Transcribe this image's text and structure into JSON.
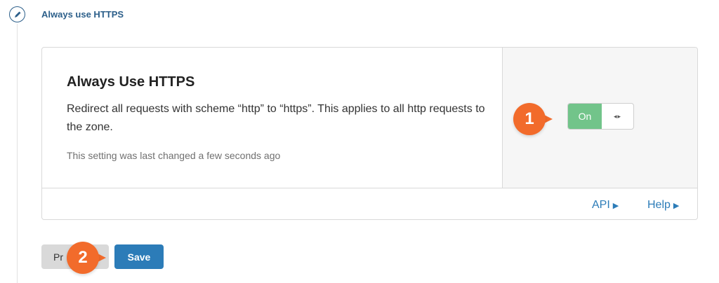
{
  "step": {
    "title": "Always use HTTPS",
    "icon": "pencil-icon"
  },
  "setting": {
    "title": "Always Use HTTPS",
    "description": "Redirect all requests with scheme “http” to “https”. This applies to all http requests to the zone.",
    "last_changed": "This setting was last changed a few seconds ago"
  },
  "toggle": {
    "state_label": "On",
    "handle_glyph": "◂▸"
  },
  "footer": {
    "api_label": "API",
    "help_label": "Help"
  },
  "buttons": {
    "previous_label": "Pr",
    "save_label": "Save"
  },
  "callouts": {
    "first": "1",
    "second": "2"
  },
  "colors": {
    "accent": "#2c7cb8",
    "toggle_on": "#72c48a",
    "callout": "#f26b2b",
    "step": "#2c5f8a"
  }
}
